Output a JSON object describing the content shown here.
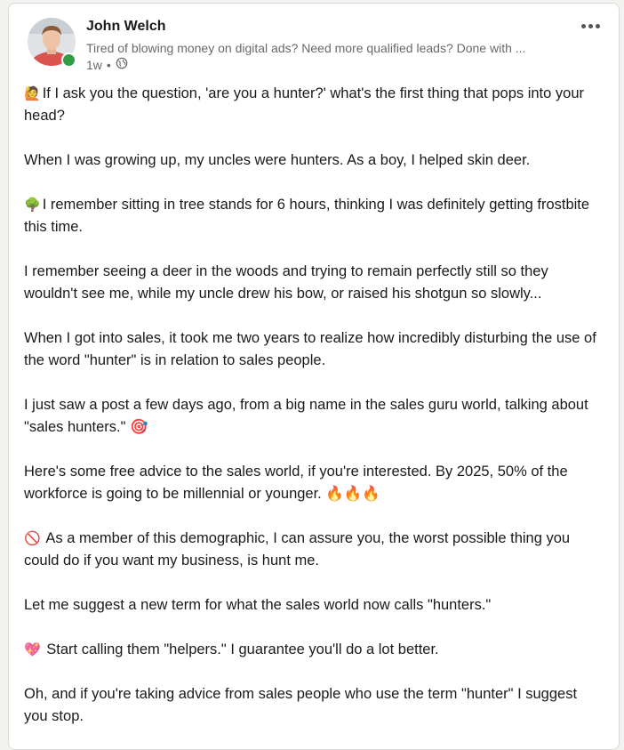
{
  "post": {
    "author_name": "John Welch",
    "headline": "Tired of blowing money on digital ads? Need more qualified leads? Done with ...",
    "time_ago": "1w",
    "separator": "•",
    "visibility_icon": "globe-icon",
    "presence_color": "#2f9e44",
    "paragraphs": [
      {
        "emoji": "🙋",
        "text": "If I ask you the question, 'are you a hunter?' what's the first thing that pops into your head?"
      },
      {
        "emoji": "",
        "text": "When I was growing up, my uncles were hunters. As a boy, I helped skin deer."
      },
      {
        "emoji": "🌳",
        "text": "I remember sitting in tree stands for 6 hours, thinking I was definitely getting frostbite this time."
      },
      {
        "emoji": "",
        "text": "I remember seeing a deer in the woods and trying to remain perfectly still so they wouldn't see me, while my uncle drew his bow, or raised his shotgun so slowly..."
      },
      {
        "emoji": "",
        "text": "When I got into sales, it took me two years to realize how incredibly disturbing the use of the word \"hunter\" is in relation to sales people."
      },
      {
        "emoji": "",
        "text": "I just saw a post a few days ago, from a big name in the sales guru world, talking about \"sales hunters.\" 🎯"
      },
      {
        "emoji": "",
        "text": "Here's some free advice to the sales world, if you're interested. By 2025, 50% of the workforce is going to be millennial or younger. 🔥🔥🔥"
      },
      {
        "emoji": "🚫",
        "text": " As a member of this demographic, I can assure you, the worst possible thing you could do if you want my business, is hunt me."
      },
      {
        "emoji": "",
        "text": "Let me suggest a new term for what the sales world now calls \"hunters.\""
      },
      {
        "emoji": "💖",
        "text": " Start calling them \"helpers.\" I guarantee you'll do a lot better."
      },
      {
        "emoji": "",
        "text": "Oh, and if you're taking advice from sales people who use the term \"hunter\" I suggest you stop."
      }
    ]
  }
}
